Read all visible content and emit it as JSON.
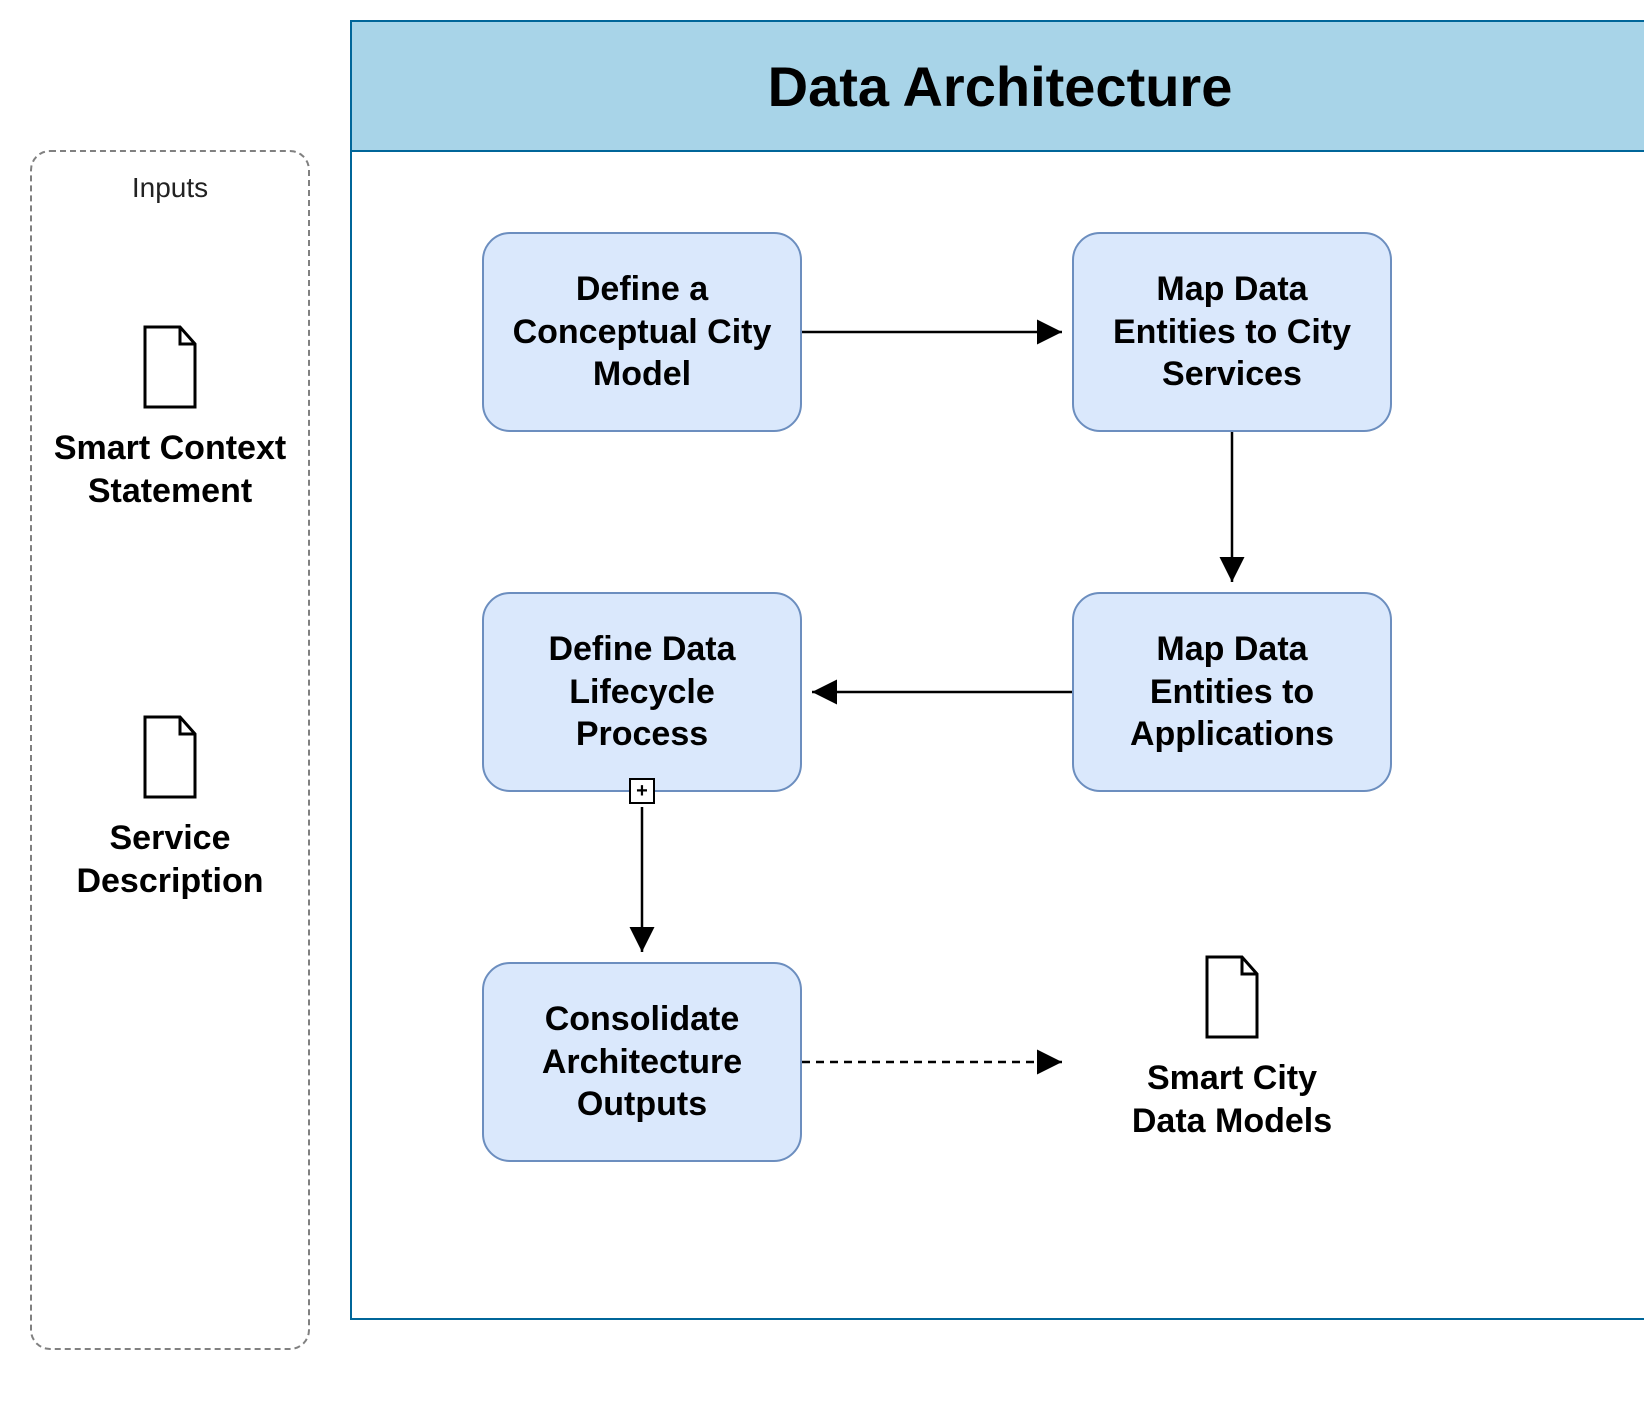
{
  "inputs": {
    "title": "Inputs",
    "items": [
      {
        "label": "Smart Context\nStatement"
      },
      {
        "label": "Service\nDescription"
      }
    ]
  },
  "main": {
    "title": "Data Architecture",
    "boxes": {
      "b1": "Define a\nConceptual City\nModel",
      "b2": "Map Data\nEntities to City\nServices",
      "b3": "Define Data\nLifecycle\nProcess",
      "b4": "Map Data\nEntities to\nApplications",
      "b5": "Consolidate\nArchitecture\nOutputs"
    },
    "output": {
      "label": "Smart City\nData Models"
    }
  }
}
